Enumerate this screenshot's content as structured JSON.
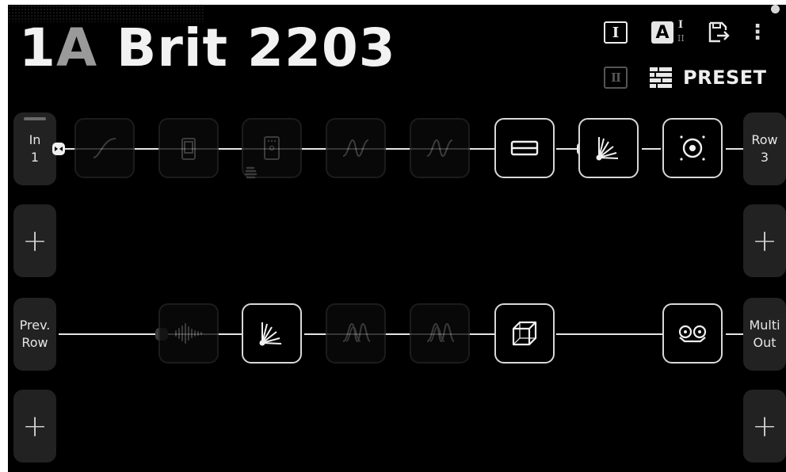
{
  "preset": {
    "number": "1",
    "letter": "A",
    "name": "Brit 2203"
  },
  "header": {
    "snapshot_1": "I",
    "snapshot_2": "II",
    "ab_letter": "A",
    "ab_top": "I",
    "ab_bottom": "II",
    "more": "⋮",
    "preset_label": "PRESET"
  },
  "row1": {
    "input_line1": "In",
    "input_line2": "1",
    "output_line1": "Row",
    "output_line2": "3",
    "blocks": [
      {
        "icon": "volume-swell-icon",
        "state": "off"
      },
      {
        "icon": "wah-pedal-icon",
        "state": "off"
      },
      {
        "icon": "stompbox-icon",
        "state": "off"
      },
      {
        "icon": "waveform-icon",
        "state": "off"
      },
      {
        "icon": "waveform-icon",
        "state": "off"
      },
      {
        "icon": "eq-slider-icon",
        "state": "on"
      },
      {
        "icon": "amp-fan-icon",
        "state": "on"
      },
      {
        "icon": "cabinet-speaker-icon",
        "state": "on"
      }
    ]
  },
  "row2": {
    "add_left": "+",
    "add_right": "+"
  },
  "row3": {
    "input_line1": "Prev.",
    "input_line2": "Row",
    "output_line1": "Multi",
    "output_line2": "Out",
    "blocks": [
      {
        "icon": "noise-gate-icon",
        "state": "off"
      },
      {
        "icon": "amp-fan-icon",
        "state": "on"
      },
      {
        "icon": "modulation-wave-icon",
        "state": "off"
      },
      {
        "icon": "modulation-wave-icon",
        "state": "off"
      },
      {
        "icon": "reverb-cube-icon",
        "state": "on"
      },
      {
        "icon": "tape-delay-icon",
        "state": "on"
      }
    ]
  },
  "row4": {
    "add_left": "+",
    "add_right": "+"
  }
}
